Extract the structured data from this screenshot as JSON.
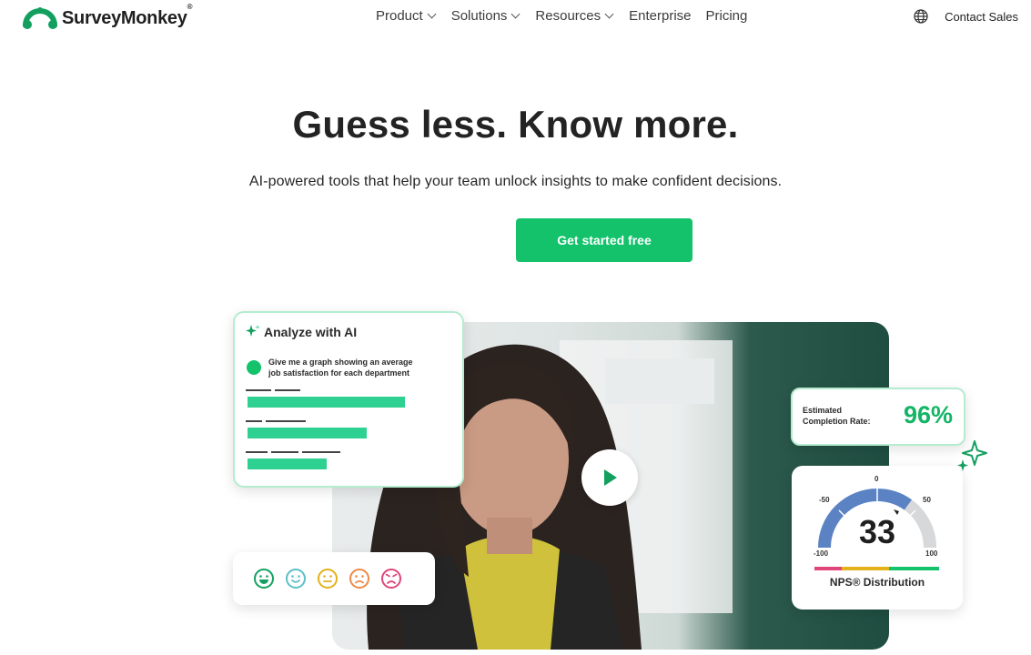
{
  "brand": {
    "name": "SurveyMonkey",
    "reg": "®",
    "color": "#13c26b"
  },
  "nav": {
    "items": [
      {
        "label": "Product",
        "dropdown": true
      },
      {
        "label": "Solutions",
        "dropdown": true
      },
      {
        "label": "Resources",
        "dropdown": true
      },
      {
        "label": "Enterprise",
        "dropdown": false
      },
      {
        "label": "Pricing",
        "dropdown": false
      }
    ],
    "language_icon": "globe-icon",
    "contact": "Contact Sales"
  },
  "hero": {
    "title": "Guess less. Know more.",
    "subtitle": "AI-powered tools that help your team unlock insights to make confident decisions.",
    "cta": "Get started free"
  },
  "ai_card": {
    "title": "Analyze with AI",
    "prompt": "Give me a graph showing an average job satisfaction for each department"
  },
  "completion": {
    "label": "Estimated Completion Rate:",
    "value": "96%"
  },
  "nps": {
    "score": "33",
    "label": "NPS® Distribution",
    "ticks": {
      "min": "-100",
      "m50": "-50",
      "zero": "0",
      "p50": "50",
      "max": "100"
    }
  },
  "emojis": [
    {
      "name": "very-happy-emoji-icon",
      "color": "#13a05f"
    },
    {
      "name": "happy-emoji-icon",
      "color": "#5bc0c6"
    },
    {
      "name": "neutral-emoji-icon",
      "color": "#e3b21a"
    },
    {
      "name": "sad-emoji-icon",
      "color": "#ef8a45"
    },
    {
      "name": "angry-emoji-icon",
      "color": "#e0457b"
    }
  ]
}
